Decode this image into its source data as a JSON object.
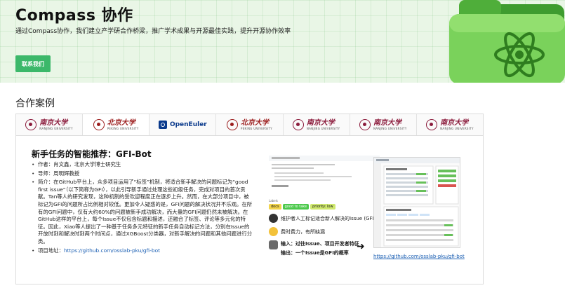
{
  "hero": {
    "title": "Compass 协作",
    "subtitle": "通过Compass协作，我们建立产学研合作桥梁，推广学术成果与开源最佳实践，提升开源协作效率",
    "cta_label": "联系我们",
    "accent_color": "#3cb86a"
  },
  "section": {
    "heading": "合作案例"
  },
  "partners": [
    {
      "type": "university",
      "cn": "南京大学",
      "en": "NANJING UNIVERSITY",
      "active": false
    },
    {
      "type": "university",
      "cn": "北京大学",
      "en": "PEKING UNIVERSITY",
      "active": true
    },
    {
      "type": "company",
      "name": "OpenEuler",
      "active": false
    },
    {
      "type": "university",
      "cn": "北京大学",
      "en": "PEKING UNIVERSITY",
      "active": false
    },
    {
      "type": "university",
      "cn": "南京大学",
      "en": "NANJING UNIVERSITY",
      "active": false
    },
    {
      "type": "university",
      "cn": "南京大学",
      "en": "NANJING UNIVERSITY",
      "active": false
    },
    {
      "type": "university",
      "cn": "南京大学",
      "en": "NANJING UNIVERSITY",
      "active": false
    }
  ],
  "case": {
    "title": "新手任务的智能推荐：GFI-Bot",
    "author": "作者：肖文鑫，北京大学博士研究生",
    "advisor": "导师：周明辉教授",
    "intro": "简介：在GitHub平台上，众多项目运用了“标签”机制，将适合新手解决的问题标记为“good first issue”（以下简称为GFI），以此引导新手通过处理这些初级任务，完成对项目的首次贡献。Tan等人的研究发现，这种机制的受欢迎程度正在逐步上升。然而，在大部分项目中，被标记为GFI的问题所占比例相对较低。更加令人疑惑的是，GFI问题的解决状况并不乐观。在所有的GFI问题中，仅有大约60%的问题被新手成功解决，而大量的GFI问题仍然未被解决。在GitHub这样的平台上，每个Issue不仅包含标题和描述，还融合了标签、评论等多元化的特征。因此，Xiao等人提出了一种基于任务多元特征的新手任务自动标记方法，分别在Issue的开放时刻和解决时刻两个时间点，通过XGBoost分类器，对新手解决的问题和其他问题进行分类。",
    "project_prefix": "项目地址：",
    "project_url": "https://github.com/osslab-pku/gfi-bot",
    "figure": {
      "labels_caption": "Labels",
      "tags": [
        "docs",
        "good to take",
        "priority: low"
      ],
      "annotations": [
        "维护者人工标记适合新人解决的Issue (GFI)",
        "费时费力，有所缺漏",
        "输入：过往Issue、项目开发者特征",
        "输出：一个Issue是GFI的概率"
      ],
      "link": "https://github.com/osslab-pku/gfi-bot"
    }
  }
}
